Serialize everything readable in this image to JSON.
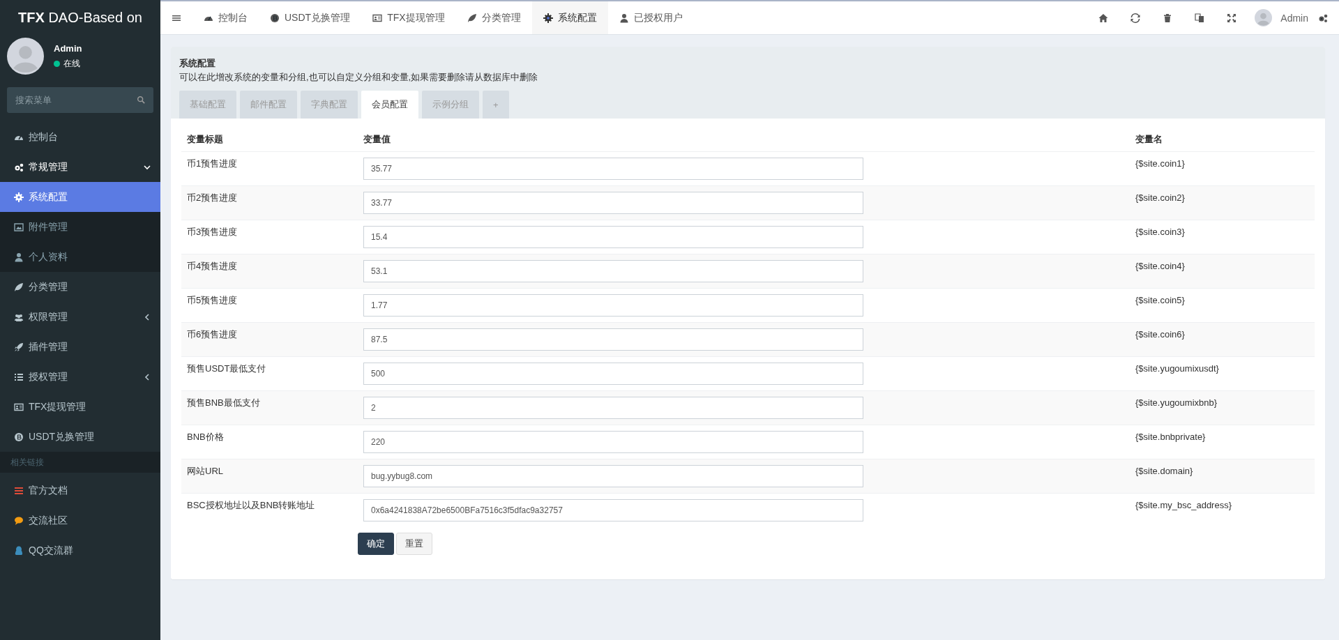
{
  "sidebar": {
    "logo": {
      "bold": "TFX",
      "rest": "DAO-Based on"
    },
    "user": {
      "name": "Admin",
      "status": "在线"
    },
    "search": {
      "placeholder": "搜索菜单"
    },
    "items": [
      {
        "kind": "item",
        "label": "控制台",
        "selected": false
      },
      {
        "kind": "item",
        "label": "常规管理",
        "selected": false,
        "expanded": true,
        "children": [
          {
            "kind": "item",
            "label": "系统配置",
            "selected": true
          },
          {
            "kind": "item",
            "label": "附件管理",
            "selected": false
          },
          {
            "kind": "item",
            "label": "个人资料",
            "selected": false
          }
        ]
      },
      {
        "kind": "item",
        "label": "分类管理",
        "selected": false
      },
      {
        "kind": "item",
        "label": "权限管理",
        "selected": false,
        "expanded": false
      },
      {
        "kind": "item",
        "label": "插件管理",
        "selected": false
      },
      {
        "kind": "item",
        "label": "授权管理",
        "selected": false,
        "expanded": false
      },
      {
        "kind": "item",
        "label": "TFX提现管理",
        "selected": false
      },
      {
        "kind": "item",
        "label": "USDT兑换管理",
        "selected": false
      },
      {
        "kind": "header",
        "label": "相关链接"
      },
      {
        "kind": "link",
        "label": "官方文档"
      },
      {
        "kind": "link",
        "label": "交流社区"
      },
      {
        "kind": "link",
        "label": "QQ交流群"
      }
    ]
  },
  "topbar": {
    "tabs": [
      {
        "label": "控制台",
        "selected": false
      },
      {
        "label": "USDT兑换管理",
        "selected": false
      },
      {
        "label": "TFX提现管理",
        "selected": false
      },
      {
        "label": "分类管理",
        "selected": false
      },
      {
        "label": "系统配置",
        "selected": true
      },
      {
        "label": "已授权用户",
        "selected": false
      }
    ],
    "user": "Admin"
  },
  "panel": {
    "title": "系统配置",
    "description": "可以在此增改系统的变量和分组,也可以自定义分组和变量,如果需要删除请从数据库中删除",
    "tabs": [
      {
        "label": "基础配置",
        "selected": false
      },
      {
        "label": "邮件配置",
        "selected": false
      },
      {
        "label": "字典配置",
        "selected": false
      },
      {
        "label": "会员配置",
        "selected": true
      },
      {
        "label": "示例分组",
        "selected": false
      },
      {
        "label": "+",
        "selected": false
      }
    ],
    "table": {
      "columns": [
        "变量标题",
        "变量值",
        "变量名"
      ],
      "rows": [
        {
          "title": "币1预售进度",
          "value": "35.77",
          "name": "{$site.coin1}"
        },
        {
          "title": "币2预售进度",
          "value": "33.77",
          "name": "{$site.coin2}"
        },
        {
          "title": "币3预售进度",
          "value": "15.4",
          "name": "{$site.coin3}"
        },
        {
          "title": "币4预售进度",
          "value": "53.1",
          "name": "{$site.coin4}"
        },
        {
          "title": "币5预售进度",
          "value": "1.77",
          "name": "{$site.coin5}"
        },
        {
          "title": "币6预售进度",
          "value": "87.5",
          "name": "{$site.coin6}"
        },
        {
          "title": "预售USDT最低支付",
          "value": "500",
          "name": "{$site.yugoumixusdt}"
        },
        {
          "title": "预售BNB最低支付",
          "value": "2",
          "name": "{$site.yugoumixbnb}"
        },
        {
          "title": "BNB价格",
          "value": "220",
          "name": "{$site.bnbprivate}"
        },
        {
          "title": "网站URL",
          "value": "bug.yybug8.com",
          "name": "{$site.domain}"
        },
        {
          "title": "BSC授权地址以及BNB转账地址",
          "value": "0x6a4241838A72be6500BFa7516c3f5dfac9a32757",
          "name": "{$site.my_bsc_address}"
        }
      ]
    },
    "buttons": [
      {
        "kind": "primary",
        "label": "确定"
      },
      {
        "kind": "default",
        "label": "重置"
      }
    ]
  }
}
